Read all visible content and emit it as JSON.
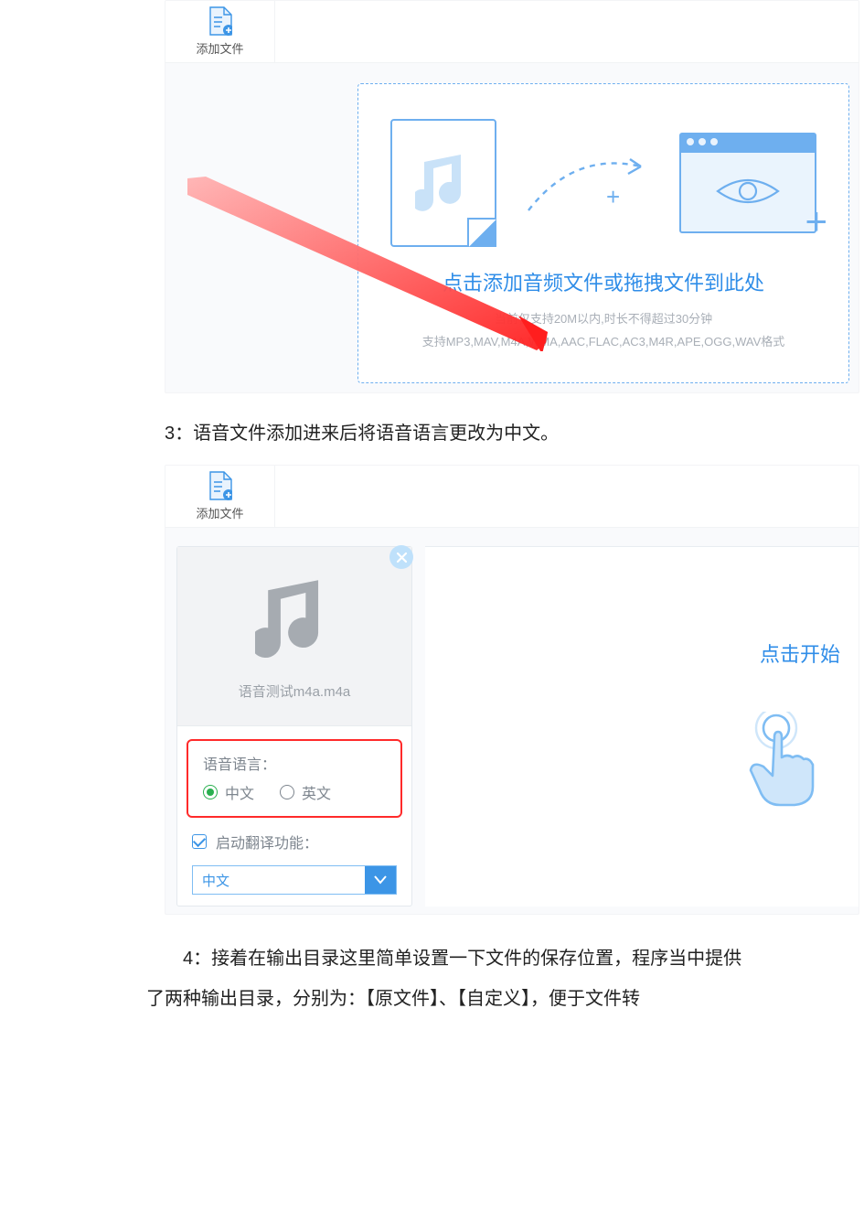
{
  "toolbar": {
    "add_file_label": "添加文件"
  },
  "drop_zone": {
    "title": "点击添加音频文件或拖拽文件到此处",
    "line1": "当前仅支持20M以内,时长不得超过30分钟",
    "line2": "支持MP3,MAV,M4A,WMA,AAC,FLAC,AC3,M4R,APE,OGG,WAV格式"
  },
  "step3": "3：语音文件添加进来后将语音语言更改为中文。",
  "file_card": {
    "file_name": "语音测试m4a.m4a"
  },
  "lang": {
    "title": "语音语言：",
    "options": {
      "zh": "中文",
      "en": "英文"
    },
    "selected": "zh"
  },
  "translate": {
    "label": "启动翻译功能：",
    "checked": true
  },
  "select": {
    "value": "中文"
  },
  "right": {
    "start_text": "点击开始"
  },
  "step4": "4：接着在输出目录这里简单设置一下文件的保存位置，程序当中提供了两种输出目录，分别为：【原文件】、【自定义】，便于文件转"
}
